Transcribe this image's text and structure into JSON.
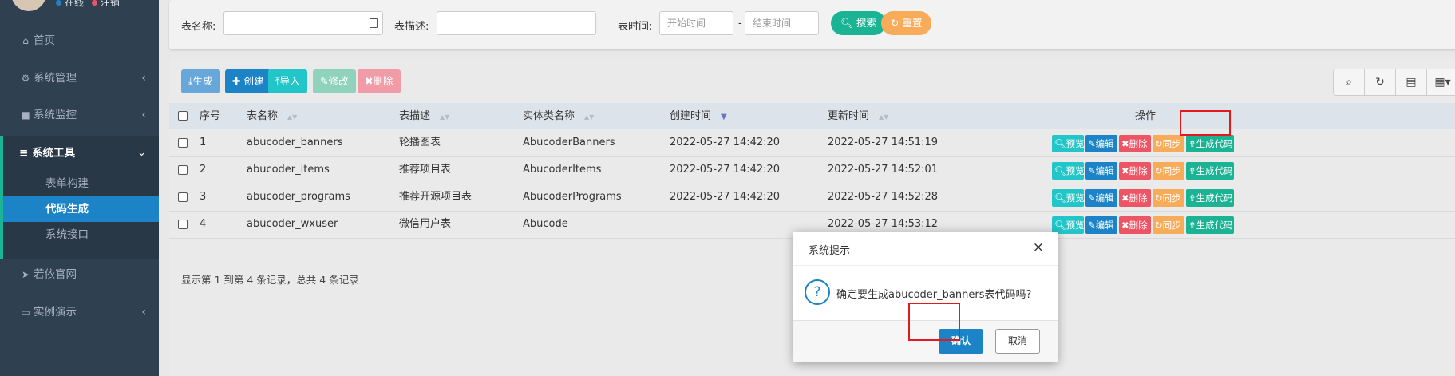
{
  "sidebar": {
    "status_online": "在线",
    "status_logout": "注销",
    "items": [
      {
        "label": "首页",
        "icon": "home-icon"
      },
      {
        "label": "系统管理",
        "icon": "gear-icon"
      },
      {
        "label": "系统监控",
        "icon": "video-icon"
      },
      {
        "label": "系统工具",
        "icon": "bars-icon"
      },
      {
        "label": "若依官网",
        "icon": "send-icon"
      },
      {
        "label": "实例演示",
        "icon": "desktop-icon"
      }
    ],
    "sub_items": [
      "表单构建",
      "代码生成",
      "系统接口"
    ]
  },
  "search": {
    "table_name_label": "表名称:",
    "table_desc_label": "表描述:",
    "table_time_label": "表时间:",
    "start_placeholder": "开始时间",
    "end_placeholder": "结束时间",
    "dash": "-",
    "search_btn": "搜索",
    "reset_btn": "重置"
  },
  "toolbar": {
    "generate": "生成",
    "create": "创建",
    "import": "导入",
    "edit": "修改",
    "delete": "删除"
  },
  "table": {
    "headers": [
      "序号",
      "表名称",
      "表描述",
      "实体类名称",
      "创建时间",
      "更新时间",
      "操作"
    ],
    "rows": [
      {
        "no": "1",
        "name": "abucoder_banners",
        "desc": "轮播图表",
        "entity": "AbucoderBanners",
        "created": "2022-05-27 14:42:20",
        "updated": "2022-05-27 14:51:19"
      },
      {
        "no": "2",
        "name": "abucoder_items",
        "desc": "推荐项目表",
        "entity": "AbucoderItems",
        "created": "2022-05-27 14:42:20",
        "updated": "2022-05-27 14:52:01"
      },
      {
        "no": "3",
        "name": "abucoder_programs",
        "desc": "推荐开源项目表",
        "entity": "AbucoderPrograms",
        "created": "2022-05-27 14:42:20",
        "updated": "2022-05-27 14:52:28"
      },
      {
        "no": "4",
        "name": "abucoder_wxuser",
        "desc": "微信用户表",
        "entity": "Abucode",
        "created": "",
        "updated": "2022-05-27 14:53:12"
      }
    ],
    "actions": {
      "preview": "预览",
      "edit": "编辑",
      "delete": "删除",
      "sync": "同步",
      "generate": "生成代码"
    },
    "footer": "显示第 1 到第 4 条记录，总共 4 条记录"
  },
  "modal": {
    "title": "系统提示",
    "close": "×",
    "icon": "?",
    "message": "确定要生成abucoder_banners表代码吗?",
    "ok": "确认",
    "cancel": "取消"
  }
}
